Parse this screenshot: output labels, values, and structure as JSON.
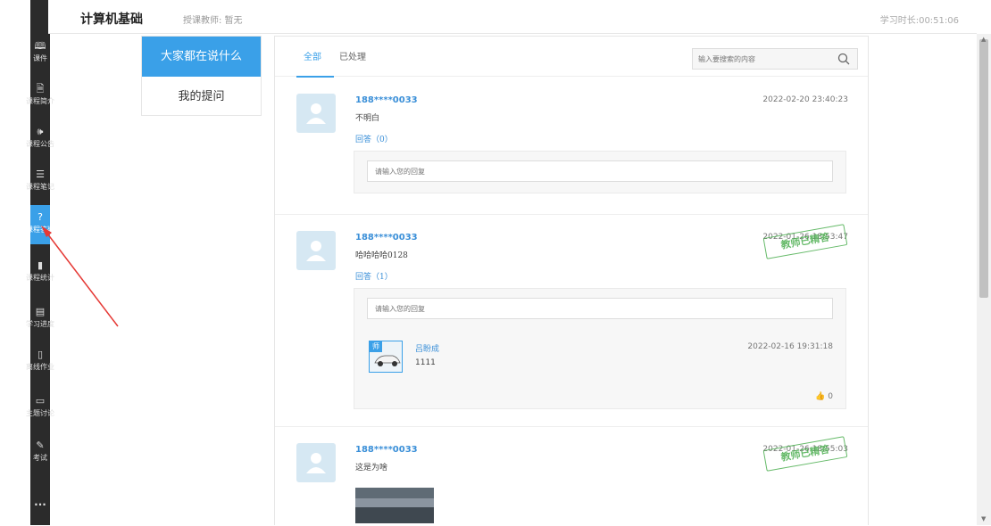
{
  "header": {
    "course_title": "计算机基础",
    "teacher": "授课教师: 暂无",
    "study_time": "学习时长:00:51:06"
  },
  "sidebar": {
    "items": [
      {
        "icon": "book-icon",
        "glyph": "🕮",
        "label": "课件"
      },
      {
        "icon": "document-icon",
        "glyph": "🗎",
        "label": "课程简介"
      },
      {
        "icon": "speaker-icon",
        "glyph": "🕪",
        "label": "课程公告"
      },
      {
        "icon": "notes-icon",
        "glyph": "☰",
        "label": "课程笔记"
      },
      {
        "icon": "question-icon",
        "glyph": "?",
        "label": "课程答疑"
      },
      {
        "icon": "bar-chart-icon",
        "glyph": "▮",
        "label": "课程统计"
      },
      {
        "icon": "progress-icon",
        "glyph": "▤",
        "label": "学习进度"
      },
      {
        "icon": "homework-icon",
        "glyph": "▯",
        "label": "离线作业"
      },
      {
        "icon": "chat-icon",
        "glyph": "▭",
        "label": "主题讨论"
      },
      {
        "icon": "exam-icon",
        "glyph": "✎",
        "label": "考试"
      }
    ],
    "more": "···",
    "active_index": 4
  },
  "left_tabs": {
    "everyone": "大家都在说什么",
    "my_questions": "我的提问"
  },
  "tabs": {
    "all": "全部",
    "processed": "已处理"
  },
  "search": {
    "placeholder": "输入要搜索的内容"
  },
  "posts": [
    {
      "user": "188****0033",
      "time": "2022-02-20 23:40:23",
      "content": "不明白",
      "reply_label": "回答（0）",
      "reply_placeholder": "请输入您的回复"
    },
    {
      "user": "188****0033",
      "time": "2022-01-26 18:53:47",
      "content": "哈哈哈哈0128",
      "reply_label": "回答（1）",
      "reply_placeholder": "请输入您的回复",
      "stamp": "教师已精答",
      "reply": {
        "badge": "师",
        "user": "吕盼成",
        "time": "2022-02-16 19:31:18",
        "text": "1111",
        "likes": "0"
      }
    },
    {
      "user": "188****0033",
      "time": "2022-01-26 18:55:03",
      "content": "这是为啥",
      "stamp": "教师已精答"
    }
  ],
  "colors": {
    "accent": "#3aa0e8",
    "sidebar_bg": "#2b2b2b",
    "stamp": "#4caf50",
    "arrow": "#e53935"
  }
}
